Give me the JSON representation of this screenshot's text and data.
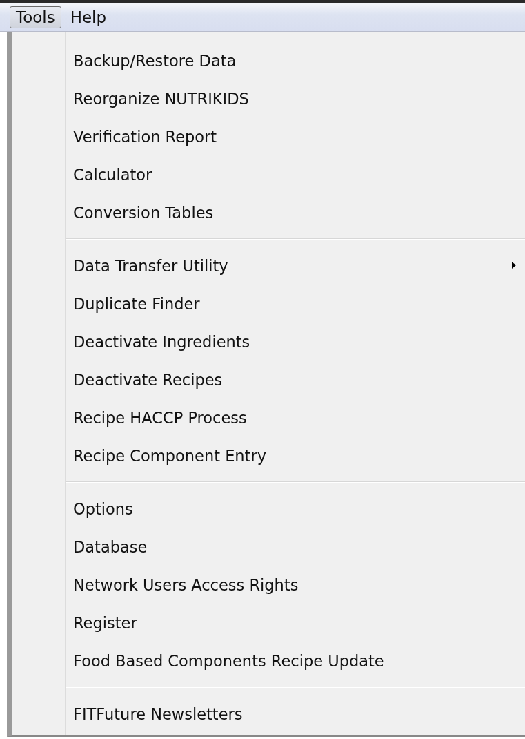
{
  "menubar": [
    {
      "label": "Tools",
      "selected": true
    },
    {
      "label": "Help",
      "selected": false
    }
  ],
  "menu": {
    "groups": [
      {
        "items": [
          {
            "label": "Backup/Restore Data",
            "submenu": false
          },
          {
            "label": "Reorganize NUTRIKIDS",
            "submenu": false
          },
          {
            "label": "Verification Report",
            "submenu": false
          },
          {
            "label": "Calculator",
            "submenu": false
          },
          {
            "label": "Conversion Tables",
            "submenu": false
          }
        ]
      },
      {
        "items": [
          {
            "label": "Data Transfer Utility",
            "submenu": true
          },
          {
            "label": "Duplicate Finder",
            "submenu": false
          },
          {
            "label": "Deactivate Ingredients",
            "submenu": false
          },
          {
            "label": "Deactivate Recipes",
            "submenu": false
          },
          {
            "label": "Recipe HACCP Process",
            "submenu": false
          },
          {
            "label": "Recipe Component Entry",
            "submenu": false
          }
        ]
      },
      {
        "items": [
          {
            "label": "Options",
            "submenu": false
          },
          {
            "label": "Database",
            "submenu": false
          },
          {
            "label": "Network Users Access Rights",
            "submenu": false
          },
          {
            "label": "Register",
            "submenu": false
          },
          {
            "label": "Food Based Components Recipe Update",
            "submenu": false
          }
        ]
      },
      {
        "items": [
          {
            "label": "FITFuture Newsletters",
            "submenu": false
          }
        ]
      }
    ]
  }
}
